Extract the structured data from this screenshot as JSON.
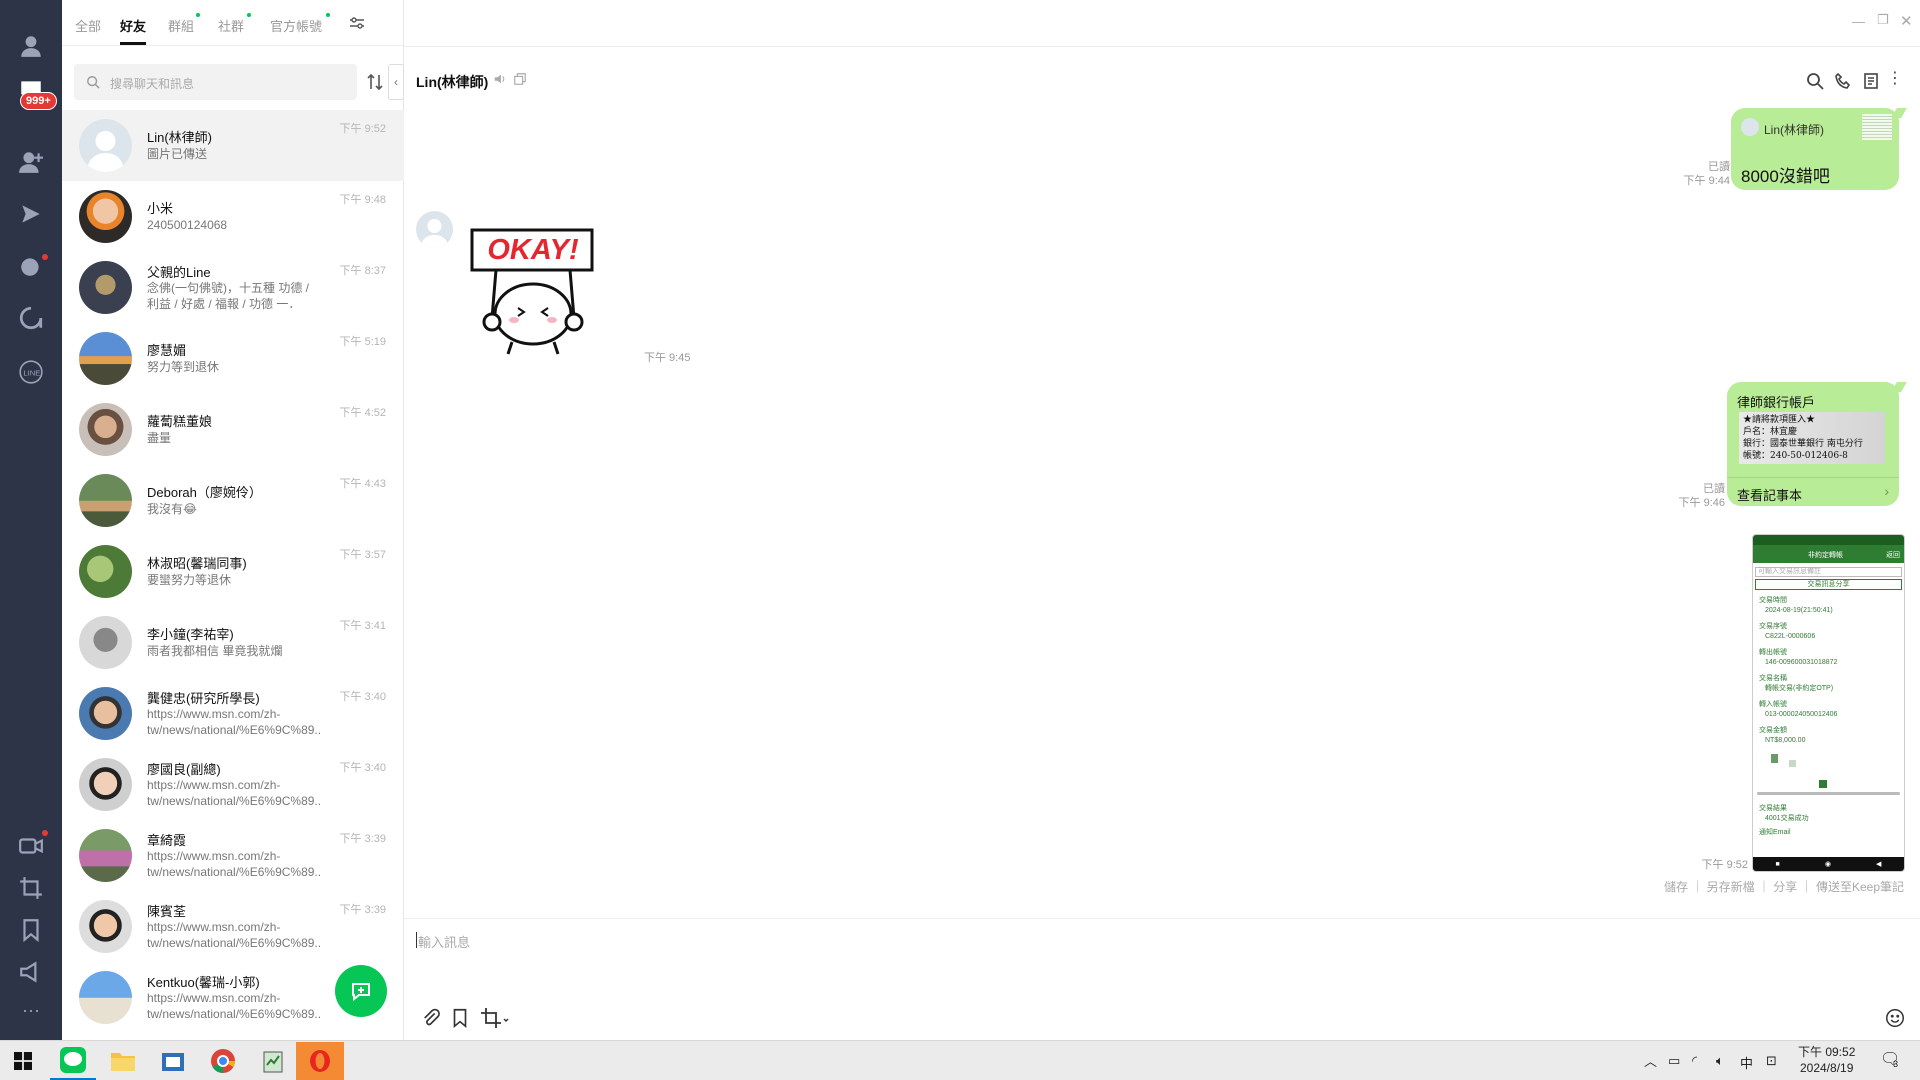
{
  "list_tabs": {
    "all": "全部",
    "friends": "好友",
    "groups": "群組",
    "community": "社群",
    "official": "官方帳號"
  },
  "search_placeholder": "搜尋聊天和訊息",
  "rail": {
    "badge": "999+"
  },
  "chats": [
    {
      "name": "Lin(林律師)",
      "preview": "圖片已傳送",
      "time": "下午 9:52"
    },
    {
      "name": "小米",
      "preview": "240500124068",
      "time": "下午 9:48"
    },
    {
      "name": "父親的Line",
      "preview": "念佛(一句佛號)，十五種 功德 / 利益 / 好處 / 福報 / 功德 一．獨...",
      "time": "下午 8:37"
    },
    {
      "name": "廖慧媚",
      "preview": "努力等到退休",
      "time": "下午 5:19"
    },
    {
      "name": "蘿蔔糕董娘",
      "preview": "盡量",
      "time": "下午 4:52"
    },
    {
      "name": "Deborah（廖婉伶）",
      "preview": "我沒有😂",
      "time": "下午 4:43"
    },
    {
      "name": "林淑昭(馨瑞同事)",
      "preview": "要蠻努力等退休",
      "time": "下午 3:57"
    },
    {
      "name": "李小鐘(李祐宰)",
      "preview": "雨者我都相信 畢竟我就爛",
      "time": "下午 3:41"
    },
    {
      "name": "龔健忠(研究所學長)",
      "preview": "https://www.msn.com/zh-tw/news/national/%E6%9C%89...",
      "time": "下午 3:40"
    },
    {
      "name": "廖國良(副總)",
      "preview": "https://www.msn.com/zh-tw/news/national/%E6%9C%89...",
      "time": "下午 3:40"
    },
    {
      "name": "章綺霞",
      "preview": "https://www.msn.com/zh-tw/news/national/%E6%9C%89...",
      "time": "下午 3:39"
    },
    {
      "name": "陳賓荃",
      "preview": "https://www.msn.com/zh-tw/news/national/%E6%9C%89...",
      "time": "下午 3:39"
    },
    {
      "name": "Kentkuo(馨瑞-小郭)",
      "preview": "https://www.msn.com/zh-tw/news/national/%E6%9C%89...",
      "time": ""
    }
  ],
  "chat": {
    "title": "Lin(林律師)",
    "reply_name": "Lin(林律師)",
    "m1_text": "8000沒錯吧",
    "m1_read": "已讀",
    "m1_time": "下午 9:44",
    "sticker_text": "OKAY!",
    "sticker_time": "下午 9:45",
    "note_title": "律師銀行帳戶",
    "note_lines": [
      "★請將款項匯入★",
      "戶名：林宜慶",
      "銀行：國泰世華銀行 南屯分行",
      "帳號：240-50-012406-8"
    ],
    "note_link": "查看記事本",
    "m2_read": "已讀",
    "m2_time": "下午 9:46",
    "img_time": "下午 9:52",
    "shot": {
      "bar_title": "非約定轉帳",
      "back": "返回",
      "input_ph": "可輸入交易訊息備註",
      "share_btn": "交易訊息分享",
      "fields": [
        [
          "交易時間",
          "2024-08-19(21:50:41)"
        ],
        [
          "交易序號",
          "C822L-0000606"
        ],
        [
          "轉出帳號",
          "146-009600031018872"
        ],
        [
          "交易名稱",
          "轉帳交易(非約定OTP)"
        ],
        [
          "轉入帳號",
          "013-000024050012406"
        ],
        [
          "交易金額",
          "NT$8,000.00"
        ]
      ],
      "result_label": "交易結果",
      "result_value": "4001交易成功",
      "notify": "通知Email"
    },
    "actions": "儲存 ｜ 另存新檔 ｜ 分享 ｜ 傳送至Keep筆記",
    "input_placeholder": "輸入訊息"
  },
  "taskbar": {
    "ime": "中",
    "time": "下午 09:52",
    "date": "2024/8/19",
    "notif": "3"
  },
  "colors": {
    "line_green": "#06c755",
    "bubble_green": "#b9ec96",
    "rail": "#2d3448",
    "badge_red": "#e53935"
  }
}
